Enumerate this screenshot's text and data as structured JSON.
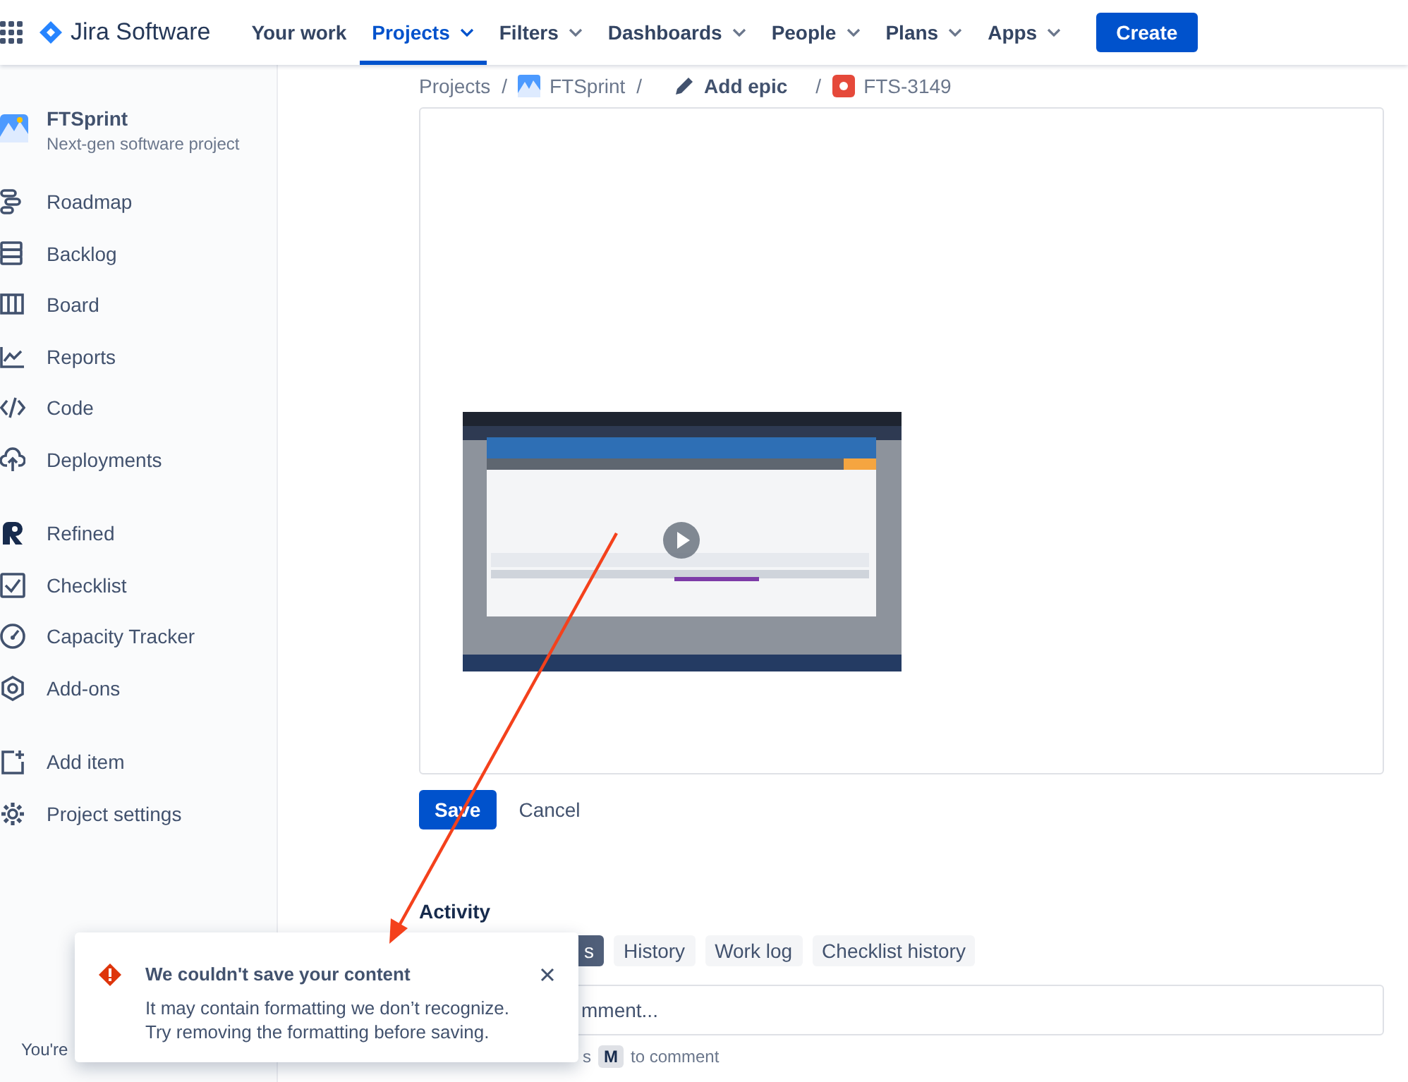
{
  "topbar": {
    "product": "Jira Software",
    "nav": [
      {
        "label": "Your work",
        "selected": false,
        "has_menu": false
      },
      {
        "label": "Projects",
        "selected": true,
        "has_menu": true
      },
      {
        "label": "Filters",
        "selected": false,
        "has_menu": true
      },
      {
        "label": "Dashboards",
        "selected": false,
        "has_menu": true
      },
      {
        "label": "People",
        "selected": false,
        "has_menu": true
      },
      {
        "label": "Plans",
        "selected": false,
        "has_menu": true
      },
      {
        "label": "Apps",
        "selected": false,
        "has_menu": true
      }
    ],
    "create_button": "Create"
  },
  "sidebar": {
    "project_name": "FTSprint",
    "project_type": "Next-gen software project",
    "groups": [
      {
        "items": [
          "Roadmap",
          "Backlog",
          "Board",
          "Reports",
          "Code",
          "Deployments"
        ]
      },
      {
        "items": [
          "Refined",
          "Checklist",
          "Capacity Tracker",
          "Add-ons"
        ]
      },
      {
        "items": [
          "Add item",
          "Project settings"
        ]
      }
    ],
    "footer": "You're"
  },
  "breadcrumb": {
    "items": [
      "Projects",
      "FTSprint",
      "Add epic",
      "FTS-3149"
    ],
    "separators": [
      "/",
      "/",
      "/"
    ]
  },
  "buttons": {
    "save": "Save",
    "cancel": "Cancel"
  },
  "activity": {
    "title": "Activity",
    "tabs": [
      {
        "label": "s",
        "selected": true
      },
      {
        "label": "History",
        "selected": false
      },
      {
        "label": "Work log",
        "selected": false
      },
      {
        "label": "Checklist history",
        "selected": false
      }
    ],
    "comment_placeholder": "mment...",
    "hint_before": "s",
    "hint_key": "M",
    "hint_after": "to comment"
  },
  "toast": {
    "title": "We couldn't save your content",
    "message": "It may contain formatting we don’t recognize. Try removing the formatting before saving."
  }
}
